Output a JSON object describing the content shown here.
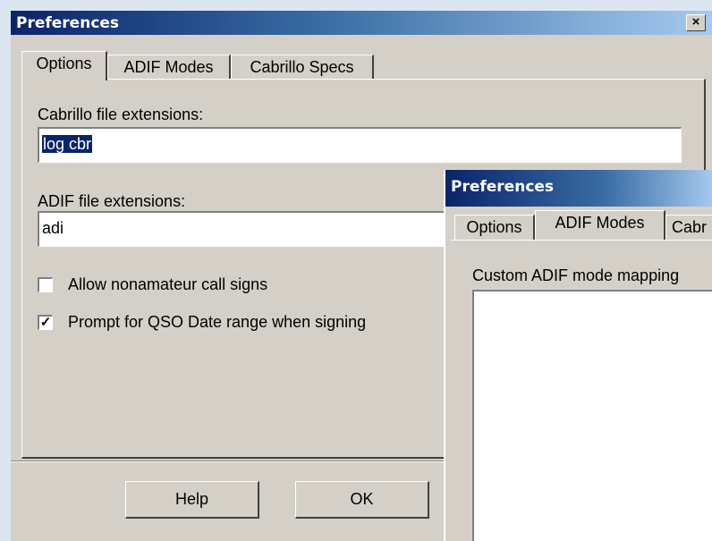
{
  "main_dialog": {
    "title": "Preferences",
    "close_glyph": "×",
    "tabs": [
      {
        "label": "Options"
      },
      {
        "label": "ADIF Modes"
      },
      {
        "label": "Cabrillo Specs"
      }
    ],
    "cabrillo": {
      "label": "Cabrillo file extensions:",
      "value": "log cbr"
    },
    "adif": {
      "label": "ADIF file extensions:",
      "value": "adi"
    },
    "checkboxes": [
      {
        "label": "Allow nonamateur call signs",
        "checked": false
      },
      {
        "label": "Prompt for QSO Date range when signing",
        "checked": true
      }
    ],
    "buttons": {
      "help": "Help",
      "ok": "OK"
    }
  },
  "second_dialog": {
    "title": "Preferences",
    "tabs": [
      {
        "label": "Options"
      },
      {
        "label": "ADIF Modes"
      },
      {
        "label": "Cabr"
      }
    ],
    "mapping_label": "Custom ADIF mode mapping"
  },
  "colors": {
    "titlebar_start": "#0a246a",
    "titlebar_end": "#a6caf0",
    "dialog_bg": "#d4d0c8",
    "selection": "#0a246a"
  },
  "icons": {
    "close": "close-icon",
    "check": "checkmark-icon"
  }
}
